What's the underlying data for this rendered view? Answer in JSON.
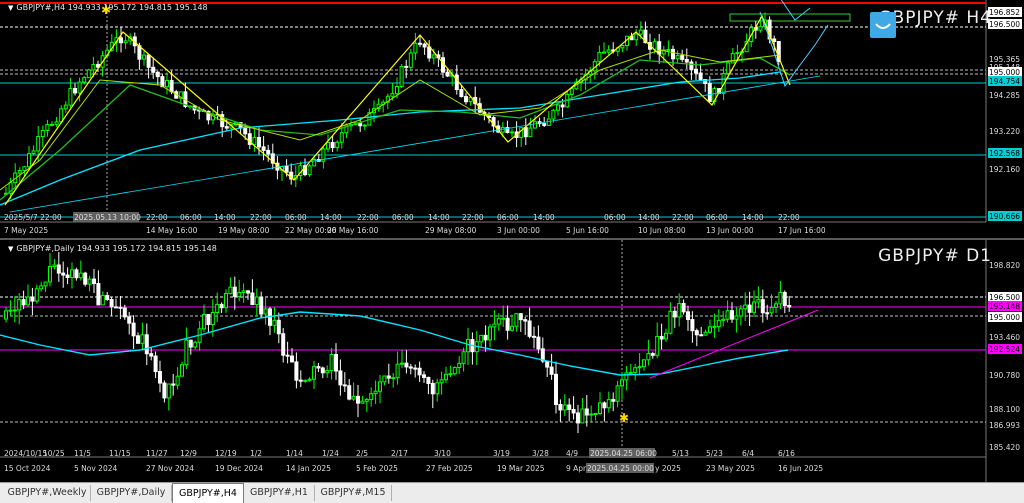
{
  "h4": {
    "symbol_info": "GBPJPY#,H4  194.933 195.172 194.815 195.148",
    "big_title": "GBPJPY# H4",
    "price_axis": [
      "196.852",
      "196.500",
      "195.365",
      "195.148",
      "195.000",
      "194.754",
      "194.285",
      "193.220",
      "192.568",
      "192.160",
      "190.666"
    ],
    "time_axis": [
      "2025/5/7 22:00",
      "2025.05.13 10:00",
      "22:00",
      "14 May 16:00",
      "06:00",
      "14:00",
      "22:00",
      "19 May 08:00",
      "22 May 00:00",
      "06:00",
      "14:00",
      "22:00",
      "26 May 16:00",
      "06:00",
      "14:00",
      "29 May 08:00",
      "22:00",
      "3 Jun 00:00",
      "06:00",
      "14:00",
      "5 Jun 16:00",
      "06:00",
      "14:00",
      "10 Jun 08:00",
      "22:00",
      "13 Jun 00:00",
      "06:00",
      "14:00",
      "22:00",
      "17 Jun 16:00"
    ],
    "time_axis_left": "7 May 2025",
    "crosshair_label": "2025.05.13 04:00"
  },
  "d1": {
    "symbol_info": "GBPJPY#,Daily  194.933 195.172 194.815 195.148",
    "big_title": "GBPJPY# D1",
    "price_axis": [
      "198.820",
      "196.500",
      "195.148",
      "195.000",
      "193.460",
      "192.524",
      "190.780",
      "188.100",
      "186.993",
      "185.420"
    ],
    "time_axis_top": [
      "2024/10/15",
      "10/25",
      "11/5",
      "11/15",
      "11/27",
      "12/9",
      "12/19",
      "1/2",
      "1/14",
      "1/24",
      "2/5",
      "2/17",
      "3/10",
      "3/19",
      "3/28",
      "4/9",
      "2025.04.25 06:00",
      "5/13",
      "5/23",
      "6/4",
      "6/16"
    ],
    "time_axis_bottom": [
      "15 Oct 2024",
      "5 Nov 2024",
      "27 Nov 2024",
      "19 Dec 2024",
      "14 Jan 2025",
      "5 Feb 2025",
      "27 Feb 2025",
      "19 Mar 2025",
      "9 Apr",
      "2025.04.25 00:00",
      "23 May 2025",
      "16 Jun 2025"
    ],
    "crosshair_tail": "y 2025"
  },
  "tabs": [
    "GBPJPY#,Weekly",
    "GBPJPY#,Daily",
    "GBPJPY#,H4",
    "GBPJPY#,H1",
    "GBPJPY#,M15"
  ],
  "active_tab": "GBPJPY#,H4",
  "colors": {
    "bull": "#00ff00",
    "bear": "#ffffff",
    "ma_fast": "#32cd32",
    "ma_slow": "#00e5ff",
    "zigzag": "#ffff00",
    "magenta": "#ff00ff",
    "cyan_level": "#00ced1",
    "red_level": "#ff0000"
  },
  "icons": {
    "trade_badge": "smile-badge-icon"
  }
}
